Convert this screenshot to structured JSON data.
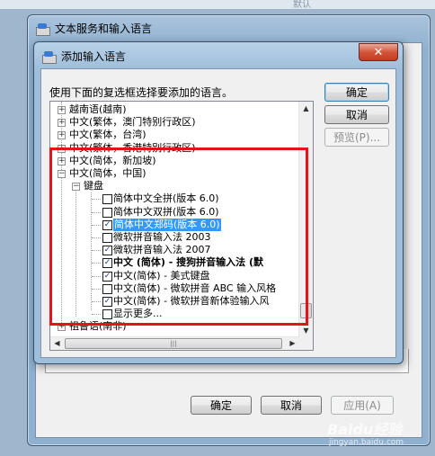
{
  "top_strip_text": "默认",
  "back_window": {
    "title": "文本服务和输入语言",
    "buttons": {
      "ok": "确定",
      "cancel": "取消",
      "apply": "应用(A)"
    }
  },
  "dialog": {
    "title": "添加输入语言",
    "close_glyph": "✕",
    "instruction": "使用下面的复选框选择要添加的语言。",
    "buttons": {
      "ok": "确定",
      "cancel": "取消",
      "preview": "预览(P)..."
    },
    "tree": [
      {
        "text": "越南语(越南)",
        "level": 0,
        "expander": "+"
      },
      {
        "text": "中文(繁体，澳门特别行政区)",
        "level": 0,
        "expander": "+"
      },
      {
        "text": "中文(繁体，台湾)",
        "level": 0,
        "expander": "+"
      },
      {
        "text": "中文(繁体，香港特别行政区)",
        "level": 0,
        "expander": "+"
      },
      {
        "text": "中文(简体，新加坡)",
        "level": 0,
        "expander": "+"
      },
      {
        "text": "中文(简体，中国)",
        "level": 0,
        "expander": "−"
      },
      {
        "text": "键盘",
        "level": 1,
        "expander": "−"
      },
      {
        "text": "简体中文全拼(版本 6.0)",
        "level": 2,
        "checked": false
      },
      {
        "text": "简体中文双拼(版本 6.0)",
        "level": 2,
        "checked": false
      },
      {
        "text": "简体中文郑码(版本 6.0)",
        "level": 2,
        "checked": true,
        "selected": true
      },
      {
        "text": "微软拼音输入法 2003",
        "level": 2,
        "checked": false
      },
      {
        "text": "微软拼音输入法 2007",
        "level": 2,
        "checked": true
      },
      {
        "text": "中文 (简体) - 搜狗拼音输入法 (默",
        "level": 2,
        "checked": true,
        "bold": true
      },
      {
        "text": "中文(简体) - 美式键盘",
        "level": 2,
        "checked": true
      },
      {
        "text": "中文(简体) - 微软拼音 ABC 输入风格",
        "level": 2,
        "checked": false
      },
      {
        "text": "中文(简体) - 微软拼音新体验输入风",
        "level": 2,
        "checked": true
      },
      {
        "text": "显示更多...",
        "level": 2,
        "checked": false
      },
      {
        "text": "祖鲁语(南非)",
        "level": 0,
        "expander": "+"
      }
    ]
  },
  "watermark": {
    "main": "Baidu经验",
    "sub": "jingyan.baidu.com"
  },
  "colors": {
    "highlight_border": "#e4131b",
    "selection": "#3399ff"
  }
}
